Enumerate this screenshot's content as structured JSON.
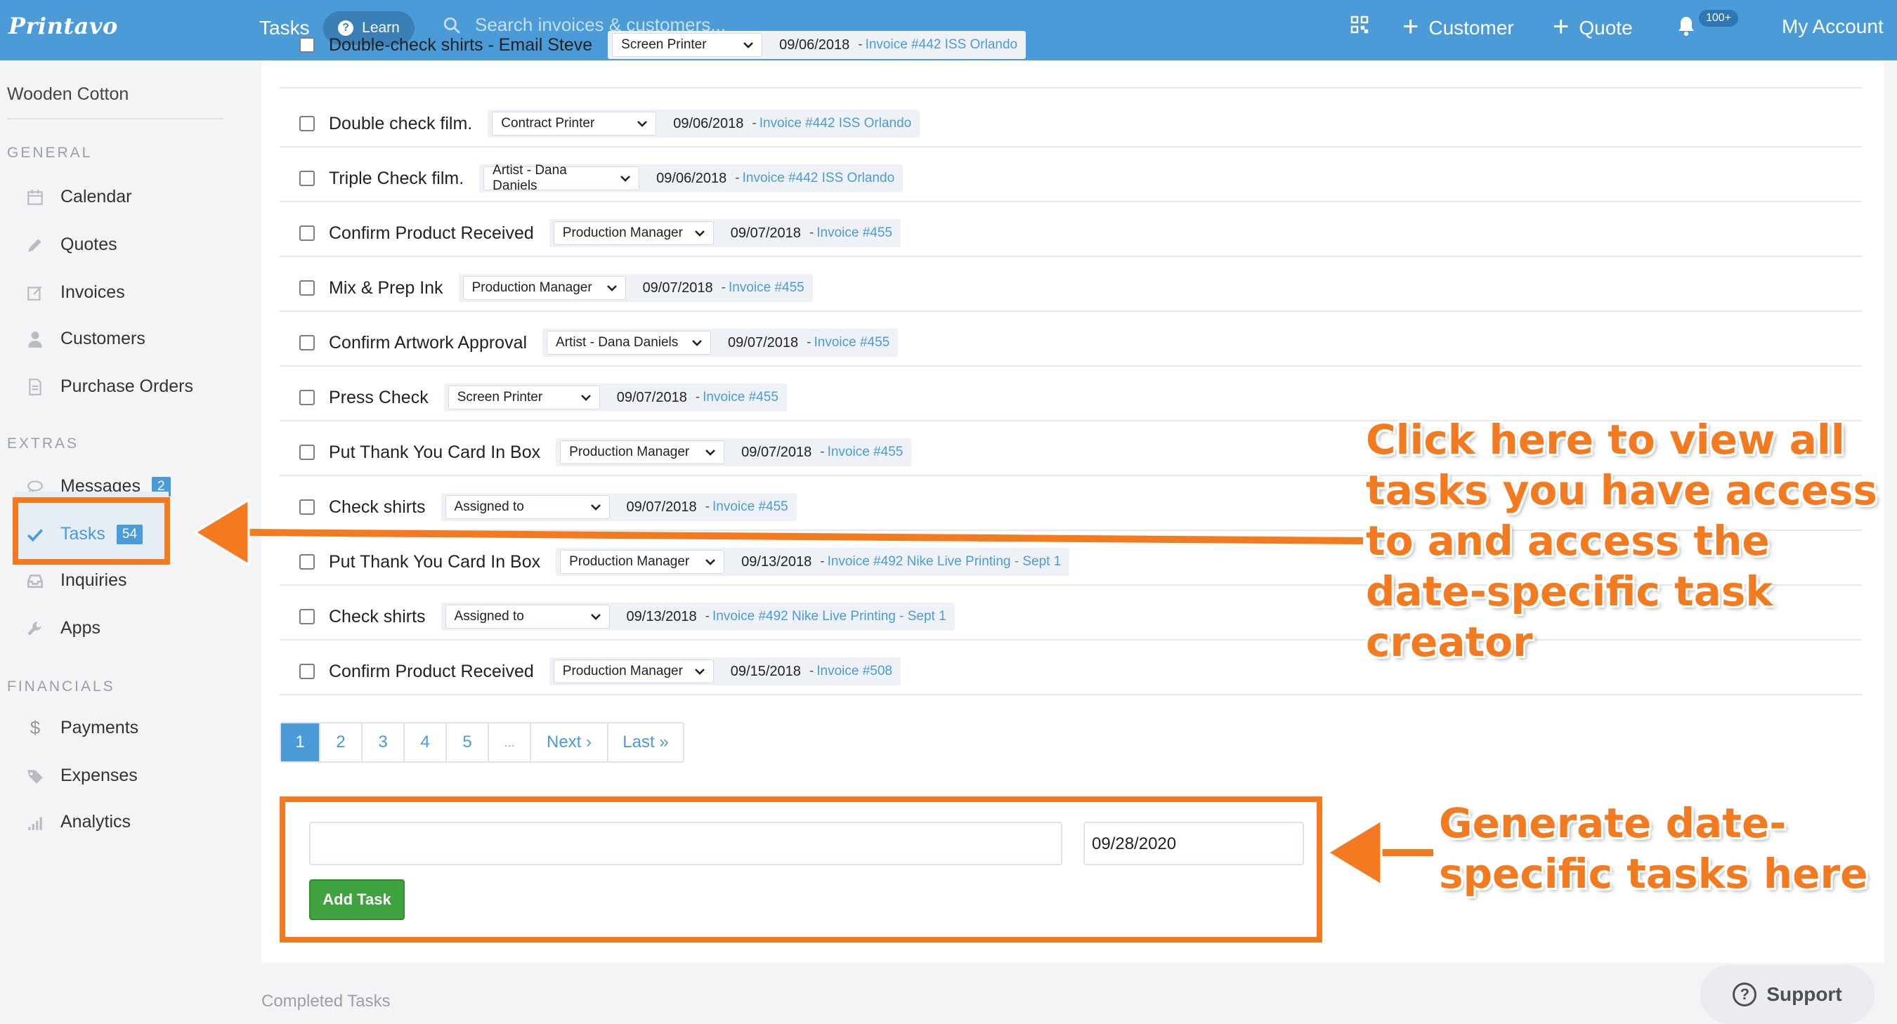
{
  "topbar": {
    "logo": "Printavo",
    "tasks": "Tasks",
    "learn": "Learn",
    "search_placeholder": "Search invoices & customers...",
    "customer": "Customer",
    "quote": "Quote",
    "notif_badge": "100+",
    "account": "My Account"
  },
  "sidebar": {
    "account_name": "Wooden Cotton",
    "general_label": "GENERAL",
    "extras_label": "EXTRAS",
    "financials_label": "FINANCIALS",
    "general": [
      {
        "label": "Calendar",
        "icon": "calendar-icon"
      },
      {
        "label": "Quotes",
        "icon": "pencil-icon"
      },
      {
        "label": "Invoices",
        "icon": "edit-icon"
      },
      {
        "label": "Customers",
        "icon": "user-icon"
      },
      {
        "label": "Purchase Orders",
        "icon": "document-icon"
      }
    ],
    "extras": [
      {
        "label": "Messages",
        "icon": "chat-icon",
        "badge": "2"
      },
      {
        "label": "Tasks",
        "icon": "check-icon",
        "badge": "54"
      },
      {
        "label": "Inquiries",
        "icon": "inbox-icon"
      },
      {
        "label": "Apps",
        "icon": "wrench-icon"
      }
    ],
    "financials": [
      {
        "label": "Payments",
        "icon": "dollar-icon"
      },
      {
        "label": "Expenses",
        "icon": "tag-icon"
      },
      {
        "label": "Analytics",
        "icon": "bar-chart-icon"
      }
    ]
  },
  "tasks": [
    {
      "title": "Double-check shirts - Email Steve",
      "assignee": "Screen Printer",
      "date": "09/06/2018",
      "link": "Invoice #442 ISS Orlando"
    },
    {
      "title": "Double check film.",
      "assignee": "Contract Printer",
      "date": "09/06/2018",
      "link": "Invoice #442 ISS Orlando"
    },
    {
      "title": "Triple Check film.",
      "assignee": "Artist - Dana Daniels",
      "date": "09/06/2018",
      "link": "Invoice #442 ISS Orlando"
    },
    {
      "title": "Confirm Product Received",
      "assignee": "Production Manager",
      "date": "09/07/2018",
      "link": "Invoice #455"
    },
    {
      "title": "Mix & Prep Ink",
      "assignee": "Production Manager",
      "date": "09/07/2018",
      "link": "Invoice #455"
    },
    {
      "title": "Confirm Artwork Approval",
      "assignee": "Artist - Dana Daniels",
      "date": "09/07/2018",
      "link": "Invoice #455"
    },
    {
      "title": "Press Check",
      "assignee": "Screen Printer",
      "date": "09/07/2018",
      "link": "Invoice #455"
    },
    {
      "title": "Put Thank You Card In Box",
      "assignee": "Production Manager",
      "date": "09/07/2018",
      "link": "Invoice #455"
    },
    {
      "title": "Check shirts",
      "assignee": "Assigned to",
      "date": "09/07/2018",
      "link": "Invoice #455"
    },
    {
      "title": "Put Thank You Card In Box",
      "assignee": "Production Manager",
      "date": "09/13/2018",
      "link": "Invoice #492 Nike Live Printing - Sept 1"
    },
    {
      "title": "Check shirts",
      "assignee": "Assigned to",
      "date": "09/13/2018",
      "link": "Invoice #492 Nike Live Printing - Sept 1"
    },
    {
      "title": "Confirm Product Received",
      "assignee": "Production Manager",
      "date": "09/15/2018",
      "link": "Invoice #508"
    }
  ],
  "pagination": {
    "pages": [
      "1",
      "2",
      "3",
      "4",
      "5",
      "..."
    ],
    "next": "Next ›",
    "last": "Last »",
    "current": "1"
  },
  "add_task": {
    "text_value": "",
    "date_value": "09/28/2020",
    "button": "Add Task"
  },
  "completed_label": "Completed Tasks",
  "support_label": "Support",
  "annotations": {
    "tasks_note": [
      "Click here to view all",
      "tasks you have access",
      "to and access the",
      "date-specific task",
      "creator"
    ],
    "generate_note": [
      "Generate date-",
      "specific tasks here"
    ],
    "color": "#f47a20"
  },
  "colors": {
    "brand": "#4a9bd8",
    "accent": "#f47a20",
    "success": "#3fa33f"
  }
}
